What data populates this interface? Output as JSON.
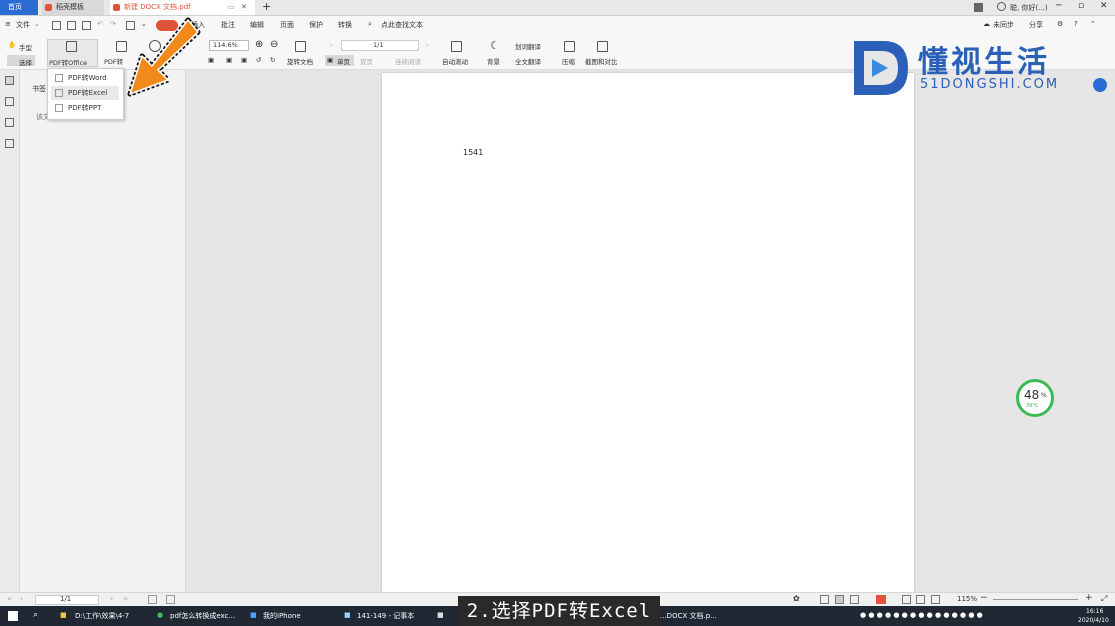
{
  "tabs": [
    {
      "label": "首页"
    },
    {
      "label": "稻壳模板"
    },
    {
      "label": "新建 DOCX 文档.pdf"
    }
  ],
  "titlebar_right": {
    "user": "聪, 你好(...)"
  },
  "menu": {
    "file": "文件",
    "items": [
      "插入",
      "批注",
      "编辑",
      "页面",
      "保护",
      "转换"
    ],
    "search": "点此查找文本",
    "sync": "未同步",
    "share": "分享"
  },
  "toolbar": {
    "hand": "手型",
    "select": "选择",
    "pdf_to_office": "PDF转Office",
    "pdf_to_image": "PDF转",
    "zoom": "114.6%",
    "rotate": "旋转文档",
    "single_page": "单页",
    "double_page": "双页",
    "continuous": "连续阅读",
    "auto_scroll": "自动滚动",
    "background": "背景",
    "translate": "划词翻译",
    "full_translate": "全文翻译",
    "compress": "压缩",
    "screenshot": "截图和对比",
    "page_input": "1/1"
  },
  "dropdown": {
    "items": [
      {
        "label": "PDF转Word"
      },
      {
        "label": "PDF转Excel"
      },
      {
        "label": "PDF转PPT"
      }
    ]
  },
  "sidepanel": {
    "tab": "书签",
    "hint": "该文档"
  },
  "document": {
    "text": "1541"
  },
  "watermark": {
    "brand": "懂视生活",
    "domain": "51DONGSHI.COM"
  },
  "widget": {
    "percent": "48",
    "unit": "%",
    "temp": "39°C"
  },
  "statusbar": {
    "page": "1/1",
    "zoom": "115%"
  },
  "taskbar": {
    "items": [
      "D:\\工作\\效果\\4-7",
      "pdf怎么转换成exc...",
      "我的iPhone",
      "141-149 - 记事本",
      "...DOCX 文档.p..."
    ],
    "time": "16:16",
    "date": "2020/4/10"
  },
  "caption": "2.选择PDF转Excel",
  "colors": {
    "accent": "#e0543c",
    "orange": "#f28a1b",
    "blue": "#2b6cd4"
  }
}
